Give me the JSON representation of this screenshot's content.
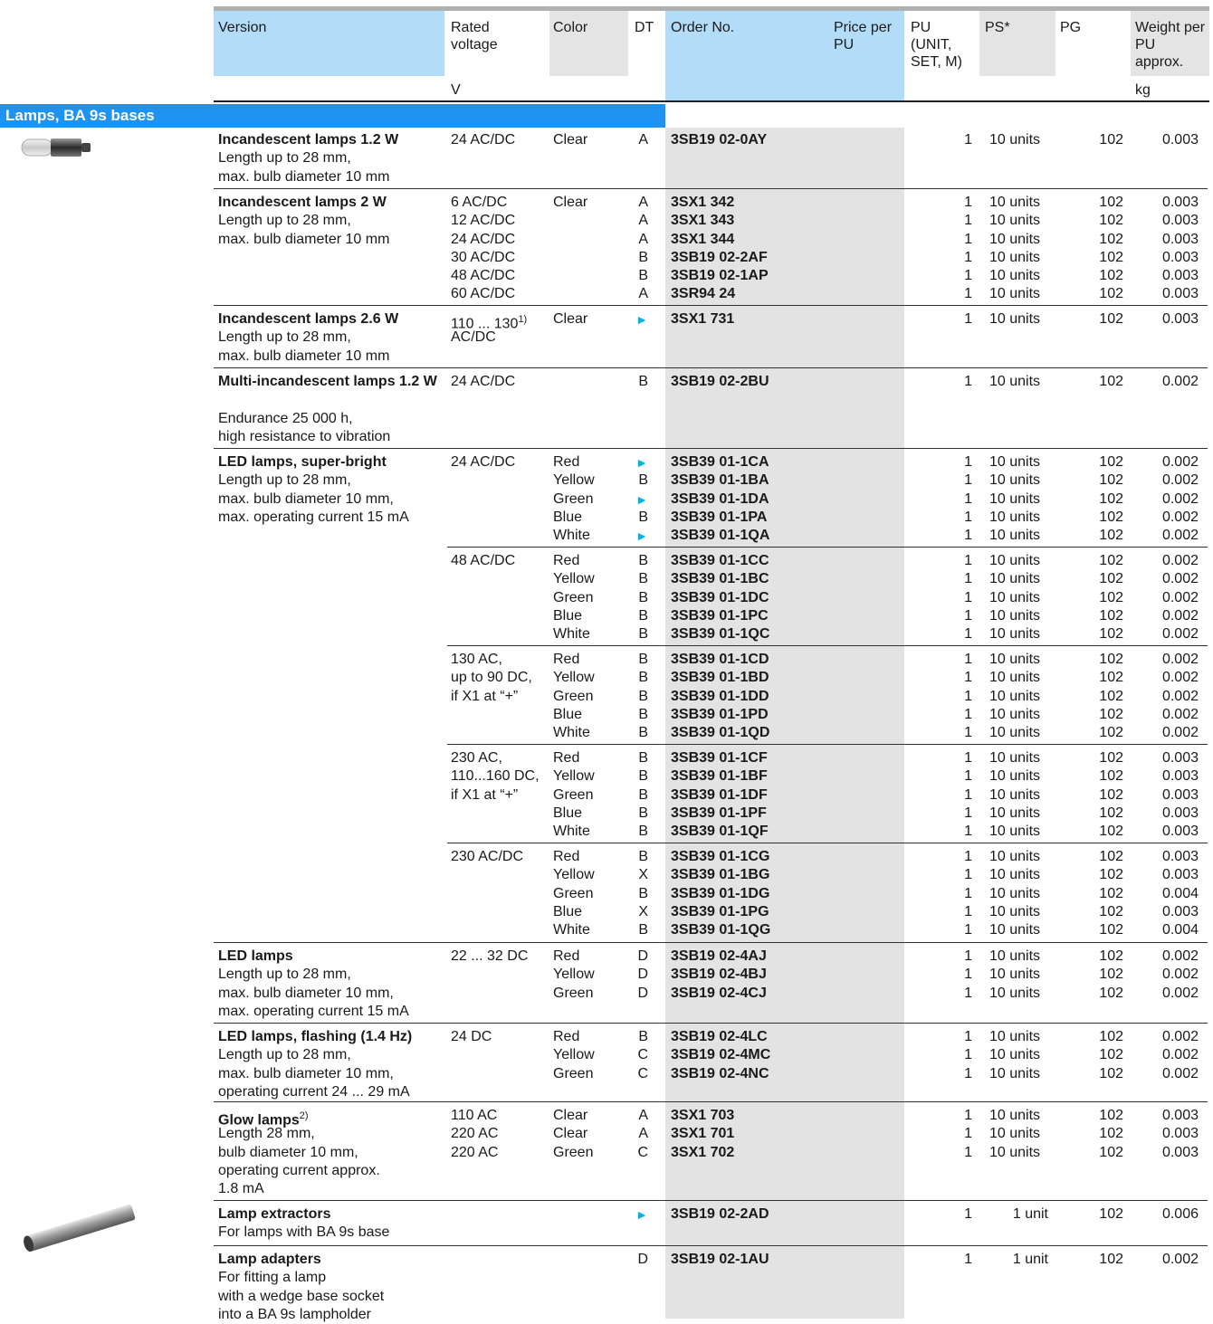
{
  "colors": {
    "header_blue": "#b3dcf8",
    "header_gray": "#e4e4e4",
    "order_col_gray": "#e3e3e3",
    "section_bar": "#1e93f2",
    "arrow": "#00b4e6"
  },
  "header": {
    "version": "Version",
    "rated_voltage": "Rated voltage",
    "color": "Color",
    "dt": "DT",
    "order_no": "Order No.",
    "price": "Price per PU",
    "pu": "PU (UNIT, SET, M)",
    "ps": "PS*",
    "pg": "PG",
    "weight": "Weight per PU approx.",
    "unit_v": "V",
    "unit_kg": "kg"
  },
  "section_title": "Lamps, BA 9s bases",
  "groups": [
    {
      "title": "Incandescent lamps 1.2 W",
      "desc": [
        "Length up to 28 mm,",
        "max. bulb diameter 10 mm"
      ],
      "voltage": [
        "24 AC/DC"
      ],
      "colors": [
        "Clear"
      ],
      "dt": [
        "A"
      ],
      "order": [
        "3SB19 02-0AY"
      ],
      "pu": [
        "1"
      ],
      "ps": [
        "10 units"
      ],
      "pg": [
        "102"
      ],
      "weight": [
        "0.003"
      ]
    },
    {
      "title": "Incandescent lamps 2 W",
      "desc": [
        "Length up to 28 mm,",
        "max. bulb diameter 10 mm"
      ],
      "voltage": [
        "6 AC/DC",
        "12 AC/DC",
        "24 AC/DC",
        "30 AC/DC",
        "48 AC/DC",
        "60 AC/DC"
      ],
      "colors": [
        "Clear"
      ],
      "dt": [
        "A",
        "A",
        "A",
        "B",
        "B",
        "A"
      ],
      "order": [
        "3SX1 342",
        "3SX1 343",
        "3SX1 344",
        "3SB19 02-2AF",
        "3SB19 02-1AP",
        "3SR94 24"
      ],
      "pu": [
        "1",
        "1",
        "1",
        "1",
        "1",
        "1"
      ],
      "ps": [
        "10 units",
        "10 units",
        "10 units",
        "10 units",
        "10 units",
        "10 units"
      ],
      "pg": [
        "102",
        "102",
        "102",
        "102",
        "102",
        "102"
      ],
      "weight": [
        "0.003",
        "0.003",
        "0.003",
        "0.003",
        "0.003",
        "0.003"
      ]
    },
    {
      "title": "Incandescent lamps 2.6 W",
      "desc": [
        "Length up to 28 mm,",
        "max. bulb diameter 10 mm"
      ],
      "voltage": [
        "110 ... 130",
        "AC/DC"
      ],
      "voltage_footnote": "1)",
      "colors": [
        "Clear"
      ],
      "dt": [
        "►"
      ],
      "order": [
        "3SX1 731"
      ],
      "pu": [
        "1"
      ],
      "ps": [
        "10 units"
      ],
      "pg": [
        "102"
      ],
      "weight": [
        "0.003"
      ]
    },
    {
      "title": "Multi-incandescent lamps 1.2 W",
      "desc": [
        "Endurance 25 000 h,",
        "high resistance to vibration"
      ],
      "voltage": [
        "24 AC/DC"
      ],
      "colors": [],
      "dt": [
        "B"
      ],
      "order": [
        "3SB19 02-2BU"
      ],
      "pu": [
        "1"
      ],
      "ps": [
        "10 units"
      ],
      "pg": [
        "102"
      ],
      "weight": [
        "0.002"
      ]
    },
    {
      "title": "LED lamps, super-bright",
      "desc": [
        "Length up to 28 mm,",
        "max. bulb diameter 10 mm,",
        "max. operating current 15 mA"
      ],
      "subgroups": [
        {
          "voltage": [
            "24 AC/DC"
          ],
          "colors": [
            "Red",
            "Yellow",
            "Green",
            "Blue",
            "White"
          ],
          "dt": [
            "►",
            "B",
            "►",
            "B",
            "►"
          ],
          "order": [
            "3SB39 01-1CA",
            "3SB39 01-1BA",
            "3SB39 01-1DA",
            "3SB39 01-1PA",
            "3SB39 01-1QA"
          ],
          "weight": [
            "0.002",
            "0.002",
            "0.002",
            "0.002",
            "0.002"
          ]
        },
        {
          "voltage": [
            "48 AC/DC"
          ],
          "colors": [
            "Red",
            "Yellow",
            "Green",
            "Blue",
            "White"
          ],
          "dt": [
            "B",
            "B",
            "B",
            "B",
            "B"
          ],
          "order": [
            "3SB39 01-1CC",
            "3SB39 01-1BC",
            "3SB39 01-1DC",
            "3SB39 01-1PC",
            "3SB39 01-1QC"
          ],
          "weight": [
            "0.002",
            "0.002",
            "0.002",
            "0.002",
            "0.002"
          ]
        },
        {
          "voltage": [
            "130 AC,",
            "up to 90 DC,",
            "if X1 at “+”"
          ],
          "colors": [
            "Red",
            "Yellow",
            "Green",
            "Blue",
            "White"
          ],
          "dt": [
            "B",
            "B",
            "B",
            "B",
            "B"
          ],
          "order": [
            "3SB39 01-1CD",
            "3SB39 01-1BD",
            "3SB39 01-1DD",
            "3SB39 01-1PD",
            "3SB39 01-1QD"
          ],
          "weight": [
            "0.002",
            "0.002",
            "0.002",
            "0.002",
            "0.002"
          ]
        },
        {
          "voltage": [
            "230 AC,",
            "110...160 DC,",
            "if X1 at “+”"
          ],
          "colors": [
            "Red",
            "Yellow",
            "Green",
            "Blue",
            "White"
          ],
          "dt": [
            "B",
            "B",
            "B",
            "B",
            "B"
          ],
          "order": [
            "3SB39 01-1CF",
            "3SB39 01-1BF",
            "3SB39 01-1DF",
            "3SB39 01-1PF",
            "3SB39 01-1QF"
          ],
          "weight": [
            "0.003",
            "0.003",
            "0.003",
            "0.003",
            "0.003"
          ]
        },
        {
          "voltage": [
            "230 AC/DC"
          ],
          "colors": [
            "Red",
            "Yellow",
            "Green",
            "Blue",
            "White"
          ],
          "dt": [
            "B",
            "X",
            "B",
            "X",
            "B"
          ],
          "order": [
            "3SB39 01-1CG",
            "3SB39 01-1BG",
            "3SB39 01-1DG",
            "3SB39 01-1PG",
            "3SB39 01-1QG"
          ],
          "weight": [
            "0.003",
            "0.003",
            "0.004",
            "0.003",
            "0.004"
          ]
        }
      ]
    },
    {
      "title": "LED lamps",
      "desc": [
        "Length up to 28 mm,",
        "max. bulb diameter 10 mm,",
        "max. operating current 15 mA"
      ],
      "voltage": [
        "22 ... 32 DC"
      ],
      "colors": [
        "Red",
        "Yellow",
        "Green"
      ],
      "dt": [
        "D",
        "D",
        "D"
      ],
      "order": [
        "3SB19 02-4AJ",
        "3SB19 02-4BJ",
        "3SB19 02-4CJ"
      ],
      "pu": [
        "1",
        "1",
        "1"
      ],
      "ps": [
        "10 units",
        "10 units",
        "10 units"
      ],
      "pg": [
        "102",
        "102",
        "102"
      ],
      "weight": [
        "0.002",
        "0.002",
        "0.002"
      ]
    },
    {
      "title": "LED lamps, flashing (1.4 Hz)",
      "desc": [
        "Length up to 28 mm,",
        "max. bulb diameter 10 mm,",
        "operating current 24 ... 29 mA"
      ],
      "voltage": [
        "24 DC"
      ],
      "colors": [
        "Red",
        "Yellow",
        "Green"
      ],
      "dt": [
        "B",
        "C",
        "C"
      ],
      "order": [
        "3SB19 02-4LC",
        "3SB19 02-4MC",
        "3SB19 02-4NC"
      ],
      "pu": [
        "1",
        "1",
        "1"
      ],
      "ps": [
        "10 units",
        "10 units",
        "10 units"
      ],
      "pg": [
        "102",
        "102",
        "102"
      ],
      "weight": [
        "0.002",
        "0.002",
        "0.002"
      ]
    },
    {
      "title": "Glow lamps",
      "title_footnote": "2)",
      "desc": [
        "Length 28 mm,",
        "bulb diameter 10 mm,",
        "operating current approx.",
        "1.8 mA"
      ],
      "voltage": [
        "110 AC",
        "220 AC",
        "220 AC"
      ],
      "colors": [
        "Clear",
        "Clear",
        "Green"
      ],
      "dt": [
        "A",
        "A",
        "C"
      ],
      "order": [
        "3SX1 703",
        "3SX1 701",
        "3SX1 702"
      ],
      "pu": [
        "1",
        "1",
        "1"
      ],
      "ps": [
        "10 units",
        "10 units",
        "10 units"
      ],
      "pg": [
        "102",
        "102",
        "102"
      ],
      "weight": [
        "0.003",
        "0.003",
        "0.003"
      ]
    },
    {
      "title": "Lamp extractors",
      "desc": [
        "For lamps with BA 9s base"
      ],
      "voltage": [],
      "colors": [],
      "dt": [
        "►"
      ],
      "order": [
        "3SB19 02-2AD"
      ],
      "pu": [
        "1"
      ],
      "ps": [
        "1 unit"
      ],
      "pg": [
        "102"
      ],
      "weight": [
        "0.006"
      ]
    },
    {
      "title": "Lamp adapters",
      "desc": [
        "For fitting a lamp",
        "with a wedge base socket",
        "into a BA 9s lampholder"
      ],
      "voltage": [],
      "colors": [],
      "dt": [
        "D"
      ],
      "order": [
        "3SB19 02-1AU"
      ],
      "pu": [
        "1"
      ],
      "ps": [
        "1 unit"
      ],
      "pg": [
        "102"
      ],
      "weight": [
        "0.002"
      ]
    }
  ],
  "images": [
    {
      "name": "lamp-bulb-image"
    },
    {
      "name": "lamp-extractor-image"
    }
  ]
}
